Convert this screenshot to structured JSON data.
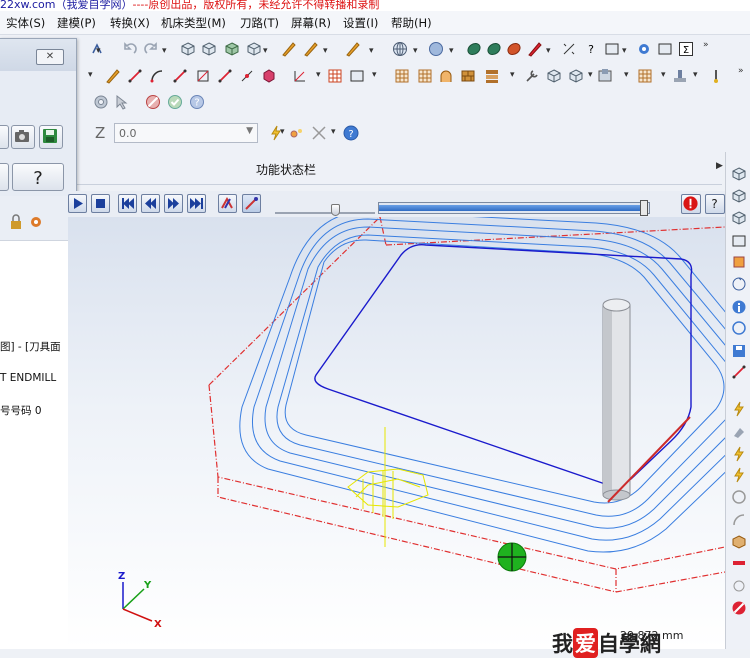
{
  "banner": {
    "text_blue": "22xw.com（我爱自学网）",
    "text_red": "----原创出品，版权所有，未经允许不得转播和录制"
  },
  "menubar": {
    "items": [
      {
        "label": "实体(S)"
      },
      {
        "label": "建模(P)"
      },
      {
        "label": "转换(X)"
      },
      {
        "label": "机床类型(M)"
      },
      {
        "label": "刀路(T)"
      },
      {
        "label": "屏幕(R)"
      },
      {
        "label": "设置(I)"
      },
      {
        "label": "帮助(H)"
      }
    ]
  },
  "zfield": {
    "label": "Z",
    "value": "0.0"
  },
  "statusbar": {
    "label": "功能状态栏"
  },
  "leftpanel": {
    "line1": "图] - [刀具面",
    "line2": "T ENDMILL",
    "line3": "号号码 0"
  },
  "playback": {
    "progress_fraction": 0.985,
    "speed_fraction": 0.6
  },
  "viewport": {
    "axis_x": "X",
    "axis_y": "Y",
    "axis_z": "Z",
    "colors": {
      "stock_outline": "#e03030",
      "toolpath": "#3a7ee0",
      "contour": "#1a1acc",
      "yellow": "#e6e600",
      "tool_marker": "#1fb21f"
    }
  },
  "watermark": {
    "logo_prefix": "我",
    "logo_highlight": "爱",
    "logo_suffix": "自學網",
    "coord": "29.872 mm"
  },
  "icons": {
    "close": "close-icon",
    "help": "help-icon",
    "camera": "camera-icon",
    "save": "save-icon",
    "stop": "stop-icon",
    "record": "record-icon"
  }
}
